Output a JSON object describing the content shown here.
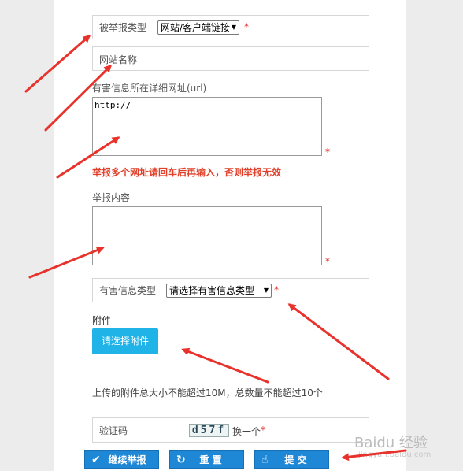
{
  "form": {
    "report_type": {
      "label": "被举报类型",
      "value": "网站/客户端链接"
    },
    "site_name": {
      "placeholder": "网站名称"
    },
    "url": {
      "label": "有害信息所在详细网址(url)",
      "value": "http://"
    },
    "warning": "举报多个网址请回车后再输入，否则举报无效",
    "content": {
      "label": "举报内容"
    },
    "harmful_type": {
      "label": "有害信息类型",
      "value": "请选择有害信息类型--"
    },
    "attachment": {
      "label": "附件",
      "button": "请选择附件",
      "note": "上传的附件总大小不能超过10M，总数量不能超过10个"
    },
    "captcha": {
      "label": "验证码",
      "code": "d57f",
      "refresh": "换一个"
    },
    "required_mark": "*"
  },
  "actions": {
    "continue": "继续举报",
    "reset": "重 置",
    "submit": "提 交"
  },
  "icons": {
    "continue": "check-icon",
    "reset": "refresh-icon",
    "submit": "pointer-icon"
  },
  "colors": {
    "accent": "#1e87d6",
    "upload": "#1fb3e8",
    "warning": "#e0402a",
    "required": "#e02020",
    "arrow": "#e8322c"
  },
  "watermark": {
    "brand": "Baidu 经验",
    "url": "jingyan.baidu.com"
  }
}
